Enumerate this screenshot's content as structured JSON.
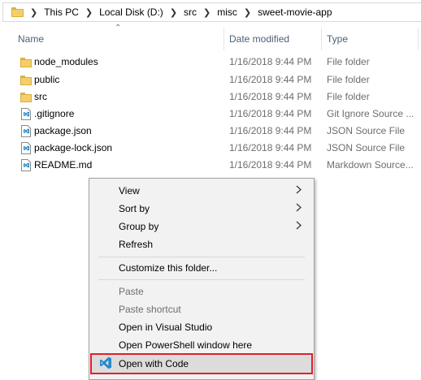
{
  "address_bar": {
    "crumbs": [
      "This PC",
      "Local Disk (D:)",
      "src",
      "misc",
      "sweet-movie-app"
    ]
  },
  "columns": {
    "name": "Name",
    "date_modified": "Date modified",
    "type": "Type"
  },
  "files": [
    {
      "name": "node_modules",
      "date": "1/16/2018 9:44 PM",
      "type": "File folder",
      "icon": "folder-icon"
    },
    {
      "name": "public",
      "date": "1/16/2018 9:44 PM",
      "type": "File folder",
      "icon": "folder-icon"
    },
    {
      "name": "src",
      "date": "1/16/2018 9:44 PM",
      "type": "File folder",
      "icon": "folder-icon"
    },
    {
      "name": ".gitignore",
      "date": "1/16/2018 9:44 PM",
      "type": "Git Ignore Source ...",
      "icon": "vscode-file-icon"
    },
    {
      "name": "package.json",
      "date": "1/16/2018 9:44 PM",
      "type": "JSON Source File",
      "icon": "vscode-file-icon"
    },
    {
      "name": "package-lock.json",
      "date": "1/16/2018 9:44 PM",
      "type": "JSON Source File",
      "icon": "vscode-file-icon"
    },
    {
      "name": "README.md",
      "date": "1/16/2018 9:44 PM",
      "type": "Markdown Source...",
      "icon": "vscode-file-icon"
    }
  ],
  "context_menu": {
    "items": [
      {
        "label": "View",
        "submenu": true,
        "enabled": true
      },
      {
        "label": "Sort by",
        "submenu": true,
        "enabled": true
      },
      {
        "label": "Group by",
        "submenu": true,
        "enabled": true
      },
      {
        "label": "Refresh",
        "submenu": false,
        "enabled": true
      },
      {
        "label": "Customize this folder...",
        "submenu": false,
        "enabled": true
      },
      {
        "label": "Paste",
        "submenu": false,
        "enabled": false
      },
      {
        "label": "Paste shortcut",
        "submenu": false,
        "enabled": false
      },
      {
        "label": "Open in Visual Studio",
        "submenu": false,
        "enabled": true
      },
      {
        "label": "Open PowerShell window here",
        "submenu": false,
        "enabled": true
      },
      {
        "label": "Open with Code",
        "submenu": false,
        "enabled": true,
        "highlighted": true,
        "icon": "vscode-icon"
      }
    ]
  },
  "colors": {
    "highlight_border": "#e0202a",
    "header_text": "#4c607a",
    "vscode_blue": "#2489ca"
  }
}
